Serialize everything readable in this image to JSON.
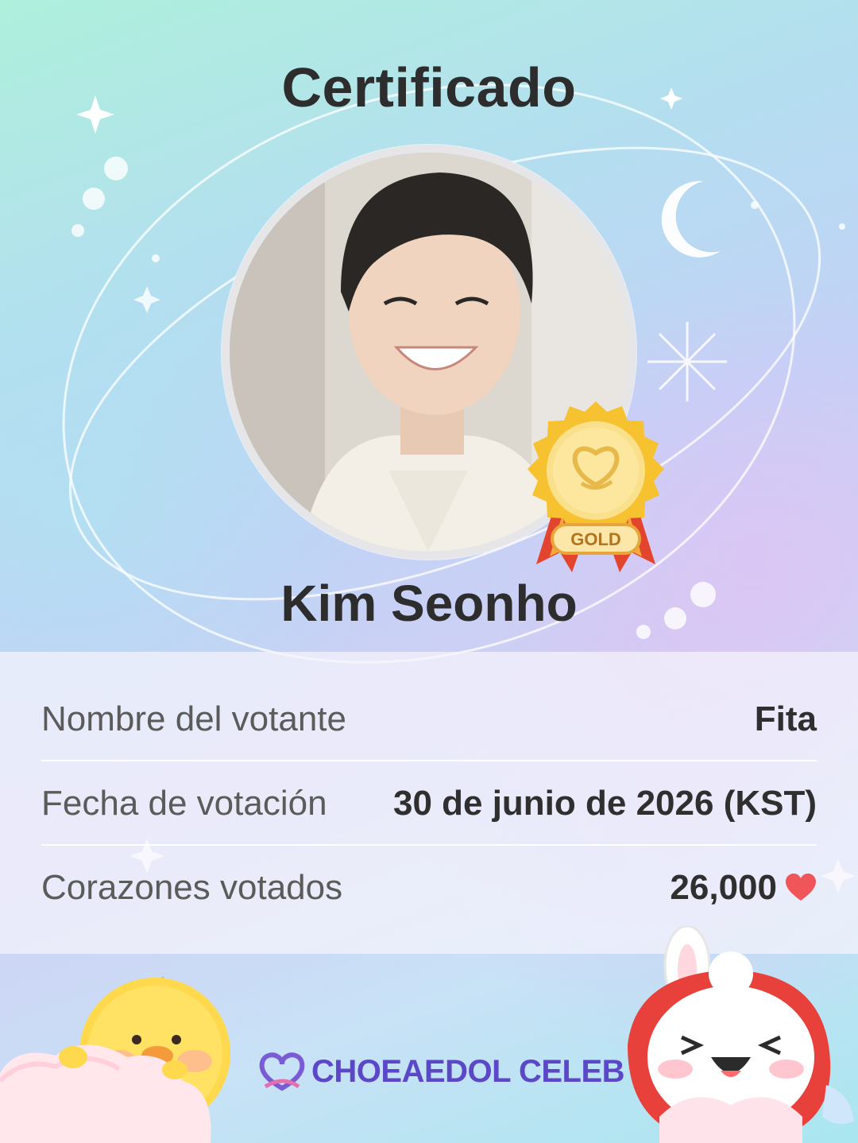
{
  "certificate": {
    "title": "Certificado",
    "name": "Kim Seonho",
    "badge_text": "GOLD"
  },
  "info": {
    "rows": [
      {
        "label": "Nombre del votante",
        "value": "Fita"
      },
      {
        "label": "Fecha de votación",
        "value": "30 de junio de 2026 (KST)"
      },
      {
        "label": "Corazones votados",
        "value": "26,000"
      }
    ]
  },
  "brand": {
    "logo_text": "CHOEAEDOL CELEB"
  },
  "colors": {
    "accent": "#5c47c8",
    "heart": "#f0555a",
    "gold": "#f5c93a"
  }
}
